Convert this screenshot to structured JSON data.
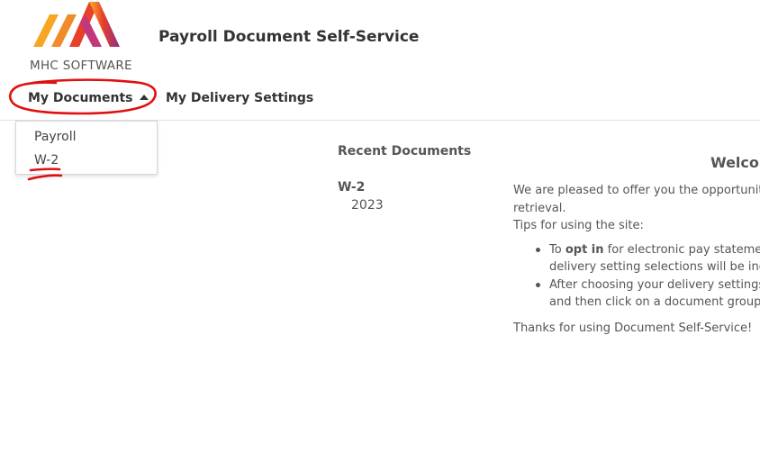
{
  "header": {
    "logo_text": "MHC SOFTWARE",
    "app_title": "Payroll Document Self-Service"
  },
  "nav": {
    "my_documents": "My Documents",
    "my_delivery_settings": "My Delivery Settings"
  },
  "dropdown": {
    "items": [
      "Payroll",
      "W-2"
    ]
  },
  "recent": {
    "heading": "Recent Documents",
    "doc_type": "W-2",
    "doc_year": "2023"
  },
  "welcome": {
    "title": "Welcor",
    "intro_1": "We are pleased to offer you the opportunity t",
    "intro_2": "retrieval.",
    "tips": "Tips for using the site:",
    "bullet1_prefix": "To ",
    "bullet1_bold": "opt in",
    "bullet1_rest": " for electronic pay statement",
    "bullet1_cont": "delivery setting selections will be indica",
    "bullet2_line1": "After choosing your delivery settings, y",
    "bullet2_cont": "and then click on a document group.",
    "thanks": "Thanks for using Document Self-Service!"
  },
  "colors": {
    "annotation_red": "#e01010",
    "logo_orange": "#f5a623",
    "logo_red": "#e8402a",
    "logo_purple": "#8b2f8a"
  }
}
